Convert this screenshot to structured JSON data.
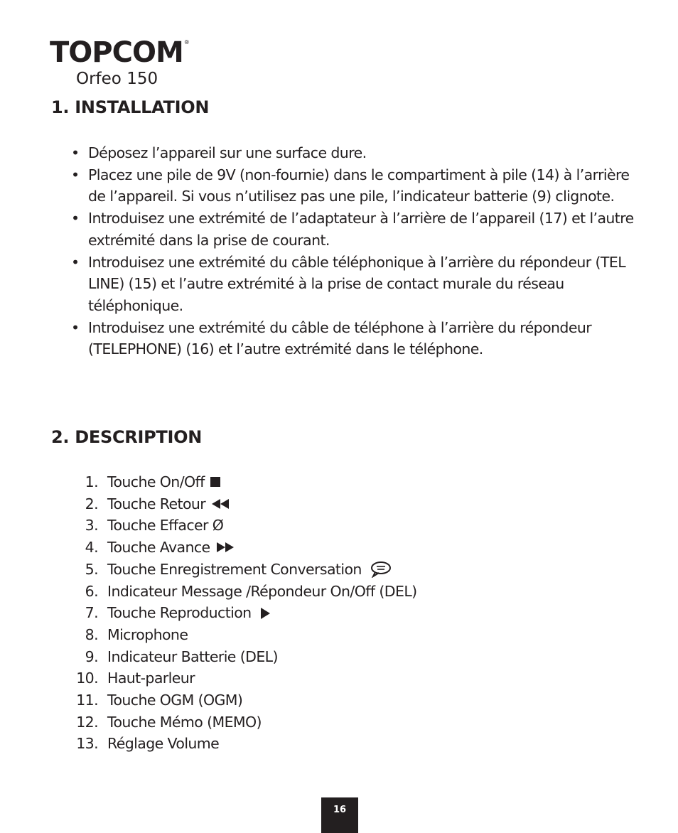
{
  "header": {
    "brand": "TOPCOM",
    "brand_mark": "®",
    "model": "Orfeo 150"
  },
  "sections": [
    {
      "title": "1. INSTALLATION",
      "bullets": [
        "Déposez l’appareil sur une surface dure.",
        "Placez une pile de 9V (non-fournie) dans le compartiment à pile (14) à l’arrière de l’appareil. Si vous n’utilisez pas une pile, l’indicateur batterie (9) clignote.",
        "Introduisez une extrémité de l’adaptateur à l’arrière de l’appareil (17) et l’autre extrémité dans la prise de courant.",
        "Introduisez une extrémité du câble téléphonique à l’arrière du répondeur (TEL LINE) (15) et l’autre extrémité à la prise de contact murale du réseau téléphonique.",
        "Introduisez une extrémité du câble de téléphone à l’arrière du répondeur (TELEPHONE) (16) et l’autre extrémité dans le téléphone."
      ]
    },
    {
      "title": "2. DESCRIPTION",
      "items": [
        {
          "num": "1.",
          "label": "Touche On/Off",
          "icon": "stop-icon"
        },
        {
          "num": "2.",
          "label": "Touche Retour",
          "icon": "rewind-icon"
        },
        {
          "num": "3.",
          "label": "Touche Effacer Ø",
          "icon": ""
        },
        {
          "num": "4.",
          "label": "Touche Avance",
          "icon": "fast-forward-icon"
        },
        {
          "num": "5.",
          "label": "Touche Enregistrement Conversation",
          "icon": "speech-bubble-icon"
        },
        {
          "num": "6.",
          "label": "Indicateur Message /Répondeur On/Off (DEL)",
          "icon": ""
        },
        {
          "num": "7.",
          "label": "Touche Reproduction",
          "icon": "play-icon"
        },
        {
          "num": "8.",
          "label": "Microphone",
          "icon": ""
        },
        {
          "num": "9.",
          "label": "Indicateur Batterie (DEL)",
          "icon": ""
        },
        {
          "num": "10.",
          "label": "Haut-parleur",
          "icon": ""
        },
        {
          "num": "11.",
          "label": "Touche OGM (OGM)",
          "icon": ""
        },
        {
          "num": "12.",
          "label": "Touche Mémo (MEMO)",
          "icon": ""
        },
        {
          "num": "13.",
          "label": "Réglage Volume",
          "icon": ""
        }
      ]
    }
  ],
  "footer": {
    "page_number": "16"
  },
  "colors": {
    "text": "#231f20",
    "page_badge_bg": "#231f20",
    "page_badge_text": "#ffffff"
  }
}
